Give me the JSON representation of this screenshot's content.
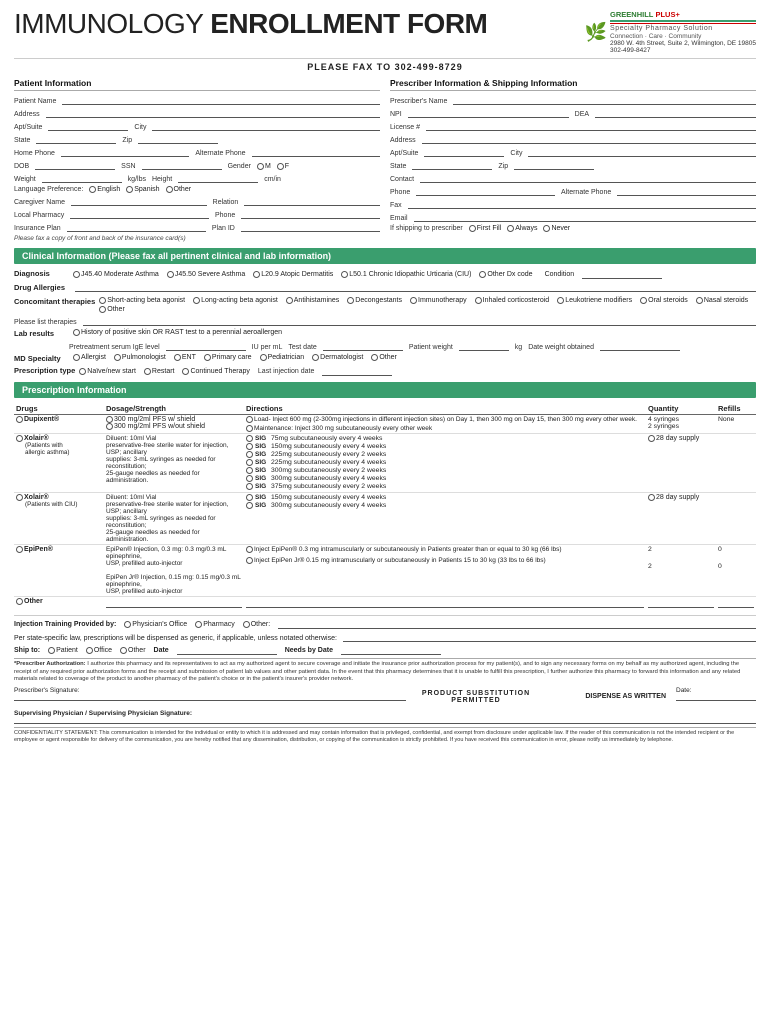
{
  "header": {
    "title_light": "IMMUNOLOGY ",
    "title_bold": "ENROLLMENT FORM",
    "fax": "PLEASE FAX TO 302-499-8729",
    "logo": {
      "leaf": "🌿",
      "name_green": "GREENHILL",
      "name_plus": "PLUS+",
      "sub": "Specialty Pharmacy Solution",
      "tagline": "Connection · Care · Community",
      "address": "2980 W. 4th Street, Suite 2, Wilmington, DE 19805",
      "phone": "302-499-8427"
    }
  },
  "patient": {
    "section_title": "Patient Information",
    "fields": {
      "patient_name": "Patient Name",
      "address": "Address",
      "apt_suite": "Apt/Suite",
      "city": "City",
      "state": "State",
      "zip": "Zip",
      "home_phone": "Home Phone",
      "alternate_phone": "Alternate Phone",
      "dob": "DOB",
      "ssn": "SSN",
      "gender": "Gender",
      "gender_m": "M",
      "gender_f": "F",
      "weight": "Weight",
      "weight_unit": "kg/lbs",
      "height": "Height",
      "height_unit": "cm/in",
      "language_pref": "Language Preference:",
      "lang_english": "English",
      "lang_spanish": "Spanish",
      "lang_other": "Other",
      "caregiver_name": "Caregiver Name",
      "relation": "Relation",
      "local_pharmacy": "Local Pharmacy",
      "phone": "Phone",
      "insurance_plan": "Insurance Plan",
      "plan_id": "Plan ID",
      "insurance_note": "Please fax a copy of front and back of the insurance card(s)"
    }
  },
  "prescriber": {
    "section_title": "Prescriber Information & Shipping Information",
    "fields": {
      "prescriber_name": "Prescriber's Name",
      "npi": "NPI",
      "dea": "DEA",
      "license": "License #",
      "address": "Address",
      "apt_suite": "Apt/Suite",
      "city": "City",
      "state": "State",
      "zip": "Zip",
      "contact": "Contact",
      "phone": "Phone",
      "alternate_phone": "Alternate Phone",
      "fax": "Fax",
      "email": "Email",
      "if_shipping": "If shipping to prescriber",
      "first_fill": "First Fill",
      "always": "Always",
      "never": "Never"
    }
  },
  "clinical": {
    "section_title": "Clinical Information (Please fax all pertinent clinical and lab information)",
    "diagnosis_label": "Diagnosis",
    "diagnosis_options": [
      "J45.40 Moderate Asthma",
      "J45.50 Severe Asthma",
      "L20.9 Atopic Dermatitis",
      "L50.1 Chronic Idiopathic Urticaria (CIU)",
      "Other Dx code",
      "Condition"
    ],
    "drug_allergies_label": "Drug Allergies",
    "concomitant_label": "Concomitant therapies",
    "concomitant_options": [
      "Short-acting beta agonist",
      "Long-acting beta agonist",
      "Antihistamines",
      "Decongestants",
      "Immunotherapy",
      "Inhaled corticosteroid",
      "Leukotriene modifiers",
      "Oral steroids",
      "Nasal steroids",
      "Other"
    ],
    "please_list": "Please list therapies",
    "lab_results_label": "Lab results",
    "lab_results_text": "History of positive skin OR RAST test to a perennial aeroallergen",
    "pretreatment": "Pretreatment serum IgE level",
    "iu_per_ml": "IU per mL",
    "test_date": "Test date",
    "patient_weight": "Patient weight",
    "kg": "kg",
    "date_weight_obtained": "Date weight obtained",
    "md_specialty_label": "MD Specialty",
    "md_options": [
      "Allergist",
      "Pulmonologist",
      "ENT",
      "Primary care",
      "Pediatrician",
      "Dermatologist",
      "Other"
    ],
    "rx_type_label": "Prescription type",
    "rx_options": [
      "Naïve/new start",
      "Restart",
      "Continued Therapy",
      "Last injection date"
    ]
  },
  "prescription": {
    "section_title": "Prescription Information",
    "col_drugs": "Drugs",
    "col_dosage": "Dosage/Strength",
    "col_directions": "Directions",
    "col_quantity": "Quantity",
    "col_refills": "Refills",
    "rows": [
      {
        "drug": "Dupixent®",
        "dosage": [
          "300 mg/2ml PFS w/ shield",
          "300 mg/2ml PFS w/out shield"
        ],
        "directions": [
          {
            "type": "radio",
            "text": "Load- Inject 600 mg (2-300mg injections in different injection sites) on Day 1, then 300 mg on Day 15, then 300 mg every other week."
          },
          {
            "type": "radio",
            "text": "Maintenance: Inject 300 mg subcutaneously every other week"
          }
        ],
        "quantity": [
          "4 syringes",
          "2 syringes"
        ],
        "refills": "None"
      },
      {
        "drug": "Xolair®",
        "drug_note": "(Patients with allergic asthma)",
        "dosage": "Diluent: 10ml Vial\npreservative-free sterile water for injection, USP; ancillary\nsupplies: 3-mL syringes as needed for reconstitution;\n25-gauge needles as needed for administration.",
        "directions": [
          {
            "sig": true,
            "text": "75mg subcutaneously every 4 weeks"
          },
          {
            "sig": true,
            "text": "150mg subcutaneously every 4 weeks"
          },
          {
            "sig": true,
            "text": "225mg subcutaneously every 2 weeks"
          },
          {
            "sig": true,
            "text": "225mg subcutaneously every 4 weeks"
          },
          {
            "sig": true,
            "text": "300mg subcutaneously every 2 weeks"
          },
          {
            "sig": true,
            "text": "300mg subcutaneously every 4 weeks"
          },
          {
            "sig": true,
            "text": "375mg subcutaneously every 2 weeks"
          }
        ],
        "quantity": "28 day supply",
        "refills": ""
      },
      {
        "drug": "Xolair®",
        "drug_note": "(Patients with CIU)",
        "dosage": "Diluent: 10ml Vial\npreservative-free sterile water for injection, USP; ancillary\nsupplies: 3-mL syringes as needed for reconstitution;\n25-gauge needles as needed for administration.",
        "directions": [
          {
            "sig": true,
            "text": "150mg subcutaneously every 4 weeks"
          },
          {
            "sig": true,
            "text": "300mg subcutaneously every 4 weeks"
          }
        ],
        "quantity": "28 day supply",
        "refills": ""
      },
      {
        "drug": "EpiPen®",
        "dosage": [
          "EpiPen® Injection, 0.3 mg: 0.3 mg/0.3 mL epinephrine, USP, prefilled auto-injector",
          "EpiPen Jr® Injection, 0.15 mg: 0.15 mg/0.3 mL epinephrine, USP, prefilled auto-injector"
        ],
        "directions": [
          {
            "type": "radio",
            "text": "Inject EpiPen® 0.3 mg intramuscularly or subcutaneously in Patients greater than or equal to 30 kg (66 lbs)"
          },
          {
            "type": "radio",
            "text": "Inject EpiPen Jr® 0.15 mg intramuscularly or subcutaneously in Patients 15 to 30 kg (33 lbs to 66 lbs)"
          }
        ],
        "quantity": [
          "2",
          "2"
        ],
        "refills": [
          "0",
          "0"
        ]
      },
      {
        "drug": "Other",
        "dosage": "",
        "directions": [],
        "quantity": "",
        "refills": ""
      }
    ]
  },
  "footer": {
    "injection_training": "Injection Training Provided by:",
    "injection_options": [
      "Physician's Office",
      "Pharmacy",
      "Other:"
    ],
    "generic_note": "Per state-specific law, prescriptions will be dispensed as generic, if applicable, unless notated otherwise:",
    "ship_to_label": "Ship to:",
    "ship_options": [
      "Patient",
      "Office",
      "Other"
    ],
    "date_label": "Date",
    "needs_by_label": "Needs by Date",
    "auth_label": "*Prescriber Authorization:",
    "auth_text": "I authorize this pharmacy and its representatives to act as my authorized agent to secure coverage and initiate the insurance prior authorization process for my patient(s), and to sign any necessary forms on my behalf as my authorized agent, including the receipt of any required prior authorization forms and the receipt and submission of patient lab values and other patient data. In the event that this pharmacy determines that it is unable to fulfill this prescription, I further authorize this pharmacy to forward this information and any related materials related to coverage of the product to another pharmacy of the patient's choice or in the patient's insurer's provider network.",
    "prescriber_sig": "Prescriber's Signature:",
    "date_sig": "Date:",
    "product_sub": "PRODUCT SUBSTITUTION PERMITTED",
    "dispense_as": "DISPENSE AS WRITTEN",
    "supervising": "Supervising Physician / Supervising Physician Signature:",
    "confidentiality": "CONFIDENTIALITY STATEMENT: This communication is intended for the individual or entity to which it is addressed and may contain information that is privileged, confidential, and exempt from disclosure under applicable law. If the reader of this communication is not the intended recipient or the employee or agent responsible for delivery of the communication, you are hereby notified that any dissemination, distribution, or copying of the communication is strictly prohibited. If you have received this communication in error, please notify us immediately by telephone."
  }
}
